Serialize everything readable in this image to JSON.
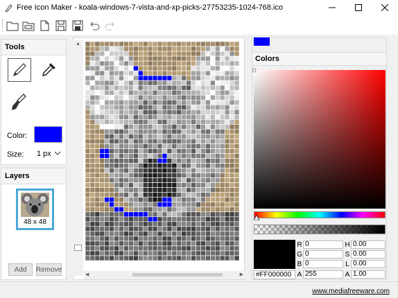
{
  "window": {
    "title": "Free Icon Maker - koala-windows-7-vista-and-xp-picks-27753235-1024-768.ico"
  },
  "toolbar": {
    "buttons": [
      "new-icon",
      "open-icon",
      "open-file-icon",
      "save-icon",
      "save-as-icon",
      "undo-icon",
      "redo-icon"
    ]
  },
  "tools_panel": {
    "title": "Tools",
    "color_label": "Color:",
    "color_value": "#0000FF",
    "size_label": "Size:",
    "size_value": "1 px"
  },
  "layers_panel": {
    "title": "Layers",
    "layer_label": "48 x 48",
    "add_label": "Add",
    "remove_label": "Remove"
  },
  "colors_panel": {
    "title": "Colors",
    "current_color": "#0000FF",
    "preview_color": "#000000",
    "hex": "#FF000000",
    "r_label": "R",
    "r_value": "0",
    "g_label": "G",
    "g_value": "0",
    "b_label": "B",
    "b_value": "0",
    "a_label": "A",
    "a_value": "255",
    "h_label": "H",
    "h_value": "0.00",
    "s_label": "S",
    "s_value": "0.00",
    "l_label": "L",
    "l_value": "0.00",
    "a2_label": "A",
    "a2_value": "1.00"
  },
  "status": {
    "site_link": "www.mediafreeware.com"
  }
}
